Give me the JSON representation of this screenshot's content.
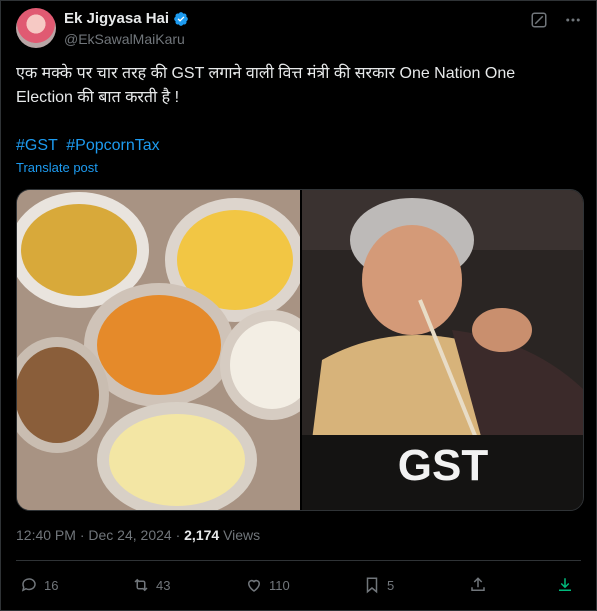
{
  "author": {
    "display_name": "Ek Jigyasa Hai",
    "handle": "@EkSawalMaiKaru"
  },
  "post": {
    "text": "एक मक्के पर चार तरह की GST लगाने वाली वित्त मंत्री की सरकार One Nation One Election की बात करती है !",
    "hashtags": [
      "#GST",
      "#PopcornTax"
    ],
    "translate_label": "Translate post"
  },
  "meta": {
    "time": "12:40 PM",
    "separator": "·",
    "date": "Dec 24, 2024",
    "separator2": "·",
    "views_count": "2,174",
    "views_label": "Views"
  },
  "actions": {
    "replies": "16",
    "reposts": "43",
    "likes": "110",
    "bookmarks": "5"
  },
  "colors": {
    "accent": "#1d9bf0",
    "text": "#e7e9ea",
    "muted": "#71767b",
    "border": "#2f3336",
    "verified": "#1d9bf0",
    "download": "#00ba7c"
  },
  "icons": [
    "verified-badge-icon",
    "grok-icon",
    "more-icon",
    "reply-icon",
    "repost-icon",
    "like-icon",
    "bookmark-icon",
    "share-icon",
    "download-icon"
  ],
  "media": {
    "left_image": "bowls of popcorn with different flavours",
    "right_image": "woman with straw over white powder spelling GST",
    "overlay_text": "GST"
  }
}
